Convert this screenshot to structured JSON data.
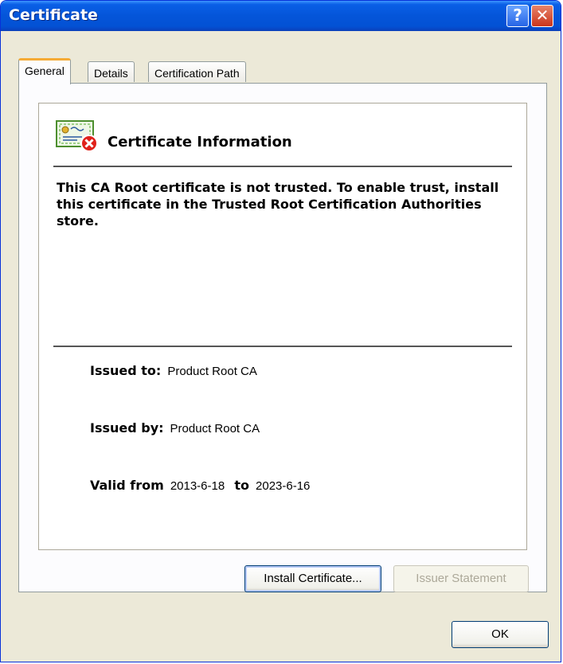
{
  "window": {
    "title": "Certificate",
    "help_glyph": "?",
    "close_glyph": "✕"
  },
  "tabs": [
    {
      "label": "General",
      "active": true
    },
    {
      "label": "Details",
      "active": false
    },
    {
      "label": "Certification Path",
      "active": false
    }
  ],
  "info": {
    "icon": "certificate-untrusted-icon",
    "title": "Certificate Information",
    "message": "This CA Root certificate is not trusted. To enable trust, install this certificate in the Trusted Root Certification Authorities store."
  },
  "details": {
    "issued_to_label": "Issued to:",
    "issued_to_value": "Product Root CA",
    "issued_by_label": "Issued by:",
    "issued_by_value": "Product Root CA",
    "valid_from_label": "Valid from",
    "valid_from_value": "2013-6-18",
    "valid_to_label": "to",
    "valid_to_value": "2023-6-16"
  },
  "buttons": {
    "install": "Install Certificate...",
    "issuer_statement": "Issuer Statement",
    "ok": "OK"
  },
  "colors": {
    "titlebar": "#0455d9",
    "dialog_bg": "#ece9d8",
    "active_tab_accent": "#f5ab36",
    "error_red": "#e0221b"
  }
}
